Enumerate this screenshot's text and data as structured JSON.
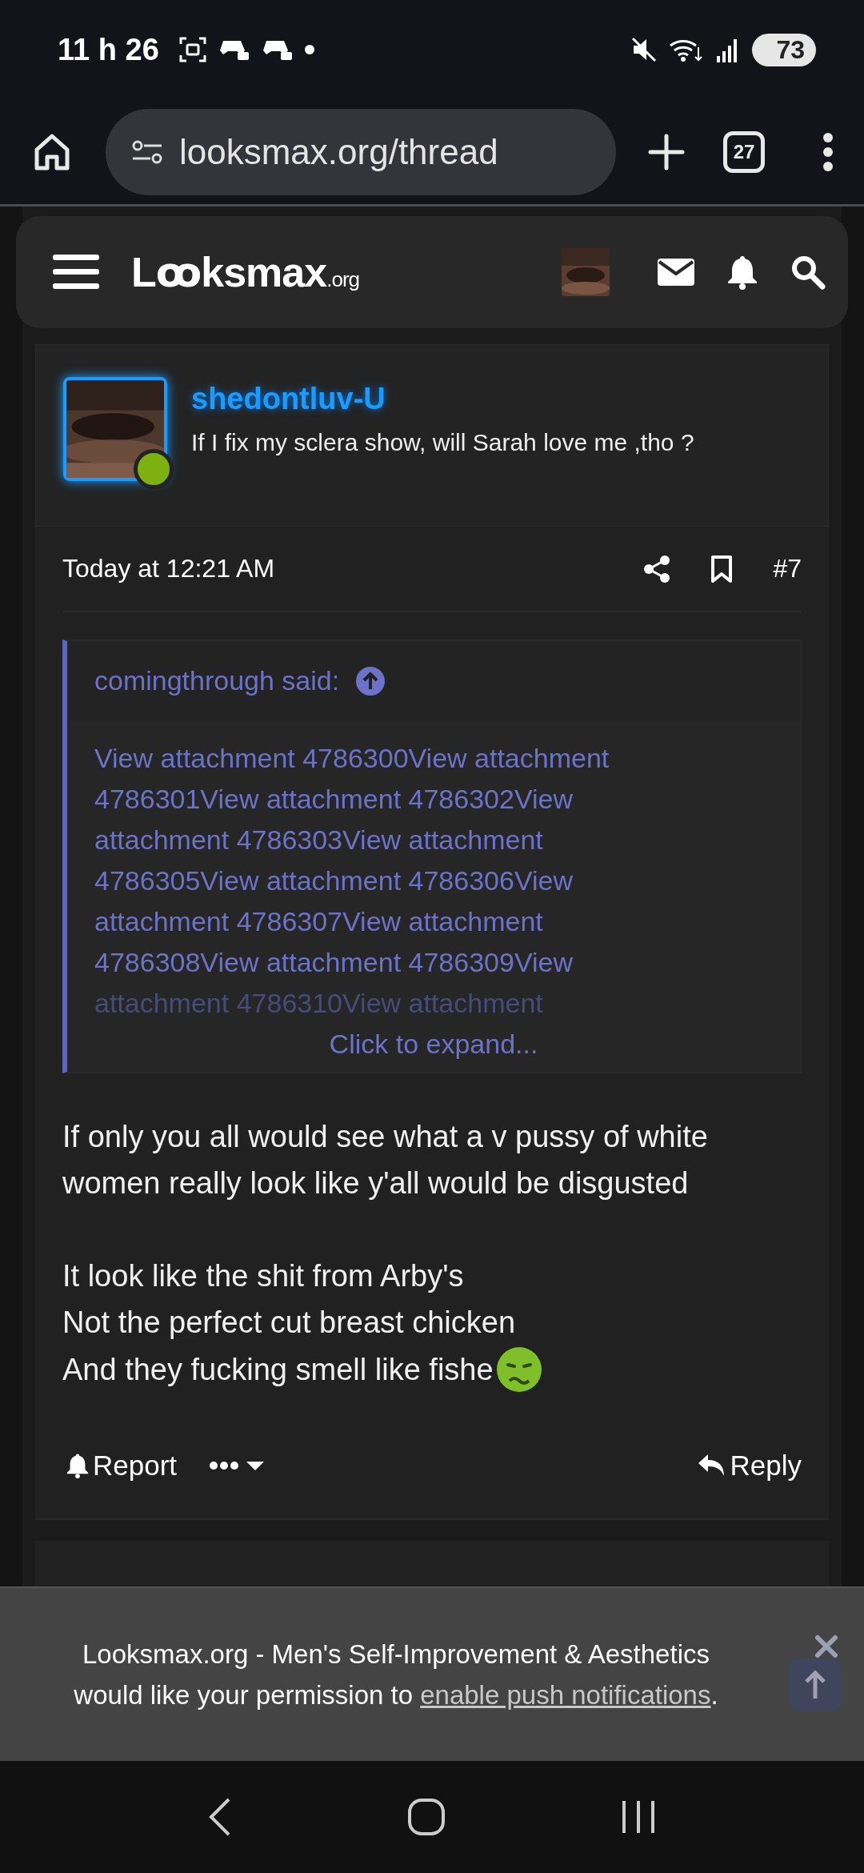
{
  "status_bar": {
    "time": "11 h 26",
    "battery": "73"
  },
  "browser": {
    "url": "looksmax.org/thread",
    "tab_count": "27"
  },
  "site_header": {
    "logo": "Lꝏksmax",
    "logo_suffix": ".org"
  },
  "post": {
    "author": {
      "name": "shedontluv-U",
      "title": "If I fix my sclera show, will Sarah love me ,tho ?",
      "online": true
    },
    "date": "Today at 12:21 AM",
    "number": "#7",
    "quote": {
      "author": "comingthrough said:",
      "lines": [
        "View attachment 4786300View attachment",
        "4786301View attachment 4786302View",
        "attachment 4786303View attachment",
        "4786305View attachment 4786306View",
        "attachment 4786307View attachment",
        "4786308View attachment 4786309View",
        "attachment 4786310View attachment"
      ],
      "expand": "Click to expand..."
    },
    "body": [
      {
        "kind": "text",
        "text": "If only you all would see what a v pussy of white women really look like y'all would be disgusted"
      },
      {
        "kind": "gap"
      },
      {
        "kind": "text",
        "text": "It look like the shit from Arby's"
      },
      {
        "kind": "text",
        "text": "Not the perfect cut breast chicken"
      },
      {
        "kind": "emoji_end",
        "text": "And they fucking smell like fishe"
      }
    ],
    "actions": {
      "report": "Report",
      "reply": "Reply"
    }
  },
  "notification": {
    "text": "Looksmax.org - Men's Self-Improvement & Aesthetics would like your permission to",
    "link": "enable push notifications",
    "end": "."
  }
}
